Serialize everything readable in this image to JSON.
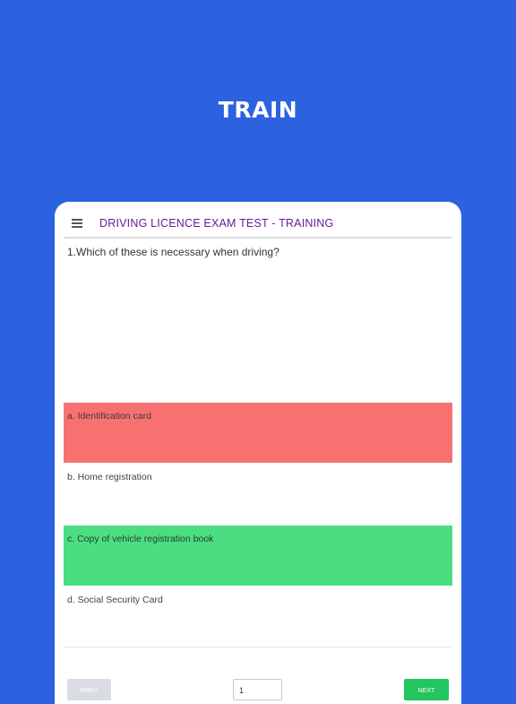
{
  "hero": {
    "title": "TRAIN"
  },
  "appbar": {
    "menu_icon": "hamburger-menu-icon",
    "title": "DRIVING LICENCE EXAM TEST - TRAINING",
    "title_color": "#6a1b9a"
  },
  "question": {
    "text": "1.Which of these is necessary when driving?"
  },
  "answers": [
    {
      "label": "a. Identification card",
      "state": "wrong",
      "color": "#f87171"
    },
    {
      "label": "b. Home registration",
      "state": "neutral",
      "color": "#ffffff"
    },
    {
      "label": "c. Copy of vehicle registration book",
      "state": "correct",
      "color": "#4ade80"
    },
    {
      "label": "d. Social Security Card",
      "state": "neutral",
      "color": "#ffffff"
    }
  ],
  "footer": {
    "prev_label": "PREV",
    "page_value": "1",
    "next_label": "NEXT",
    "next_color": "#22c55e"
  },
  "colors": {
    "background": "#2c62e0",
    "device": "#ffffff"
  }
}
